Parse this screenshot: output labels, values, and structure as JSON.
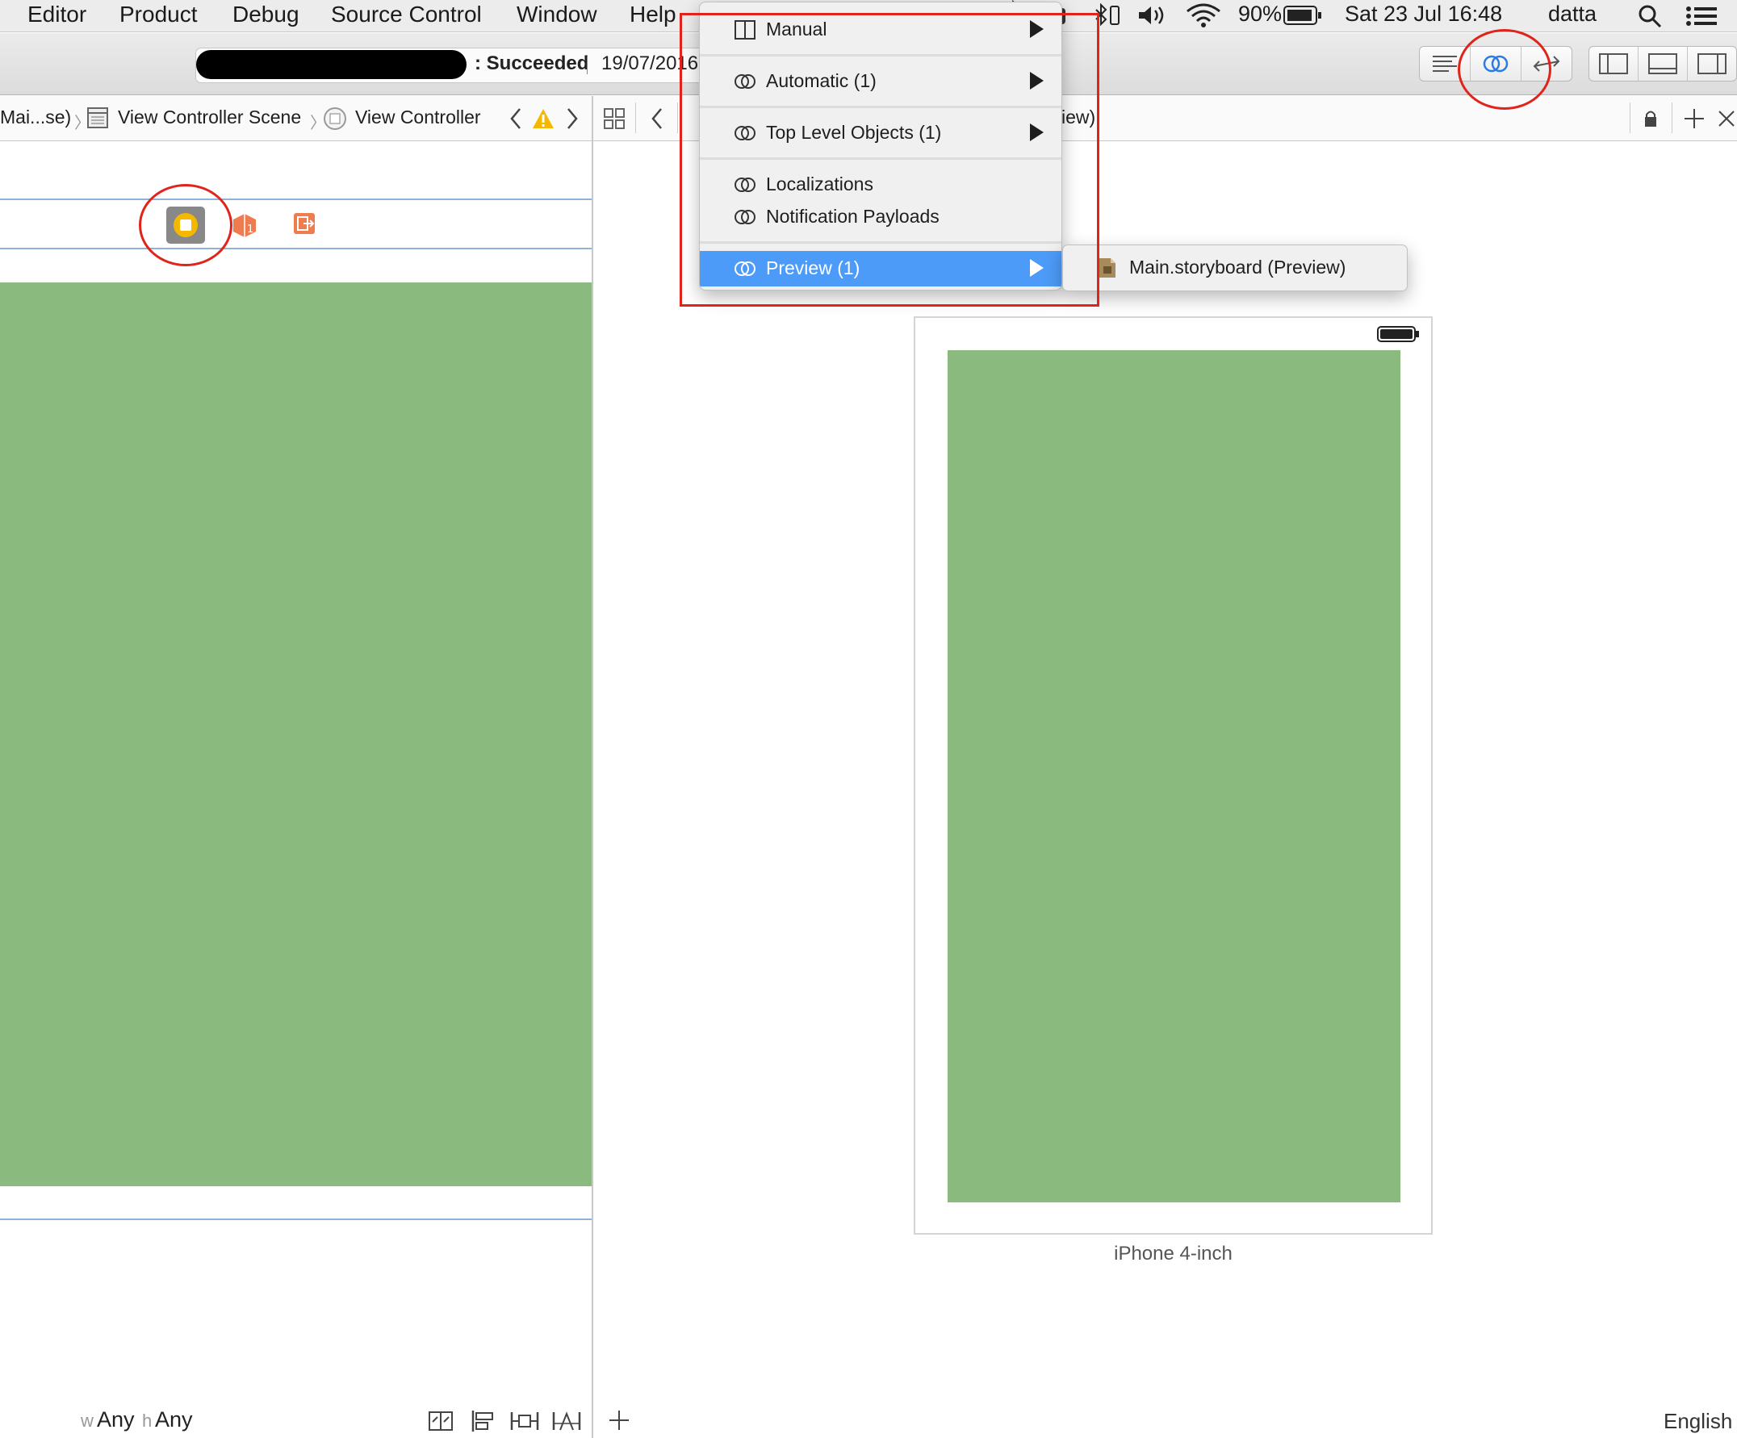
{
  "menubar": {
    "items": [
      "Editor",
      "Product",
      "Debug",
      "Source Control",
      "Window",
      "Help"
    ],
    "battery_percent": "90%",
    "datetime": "Sat 23 Jul  16:48",
    "user": "datta"
  },
  "toolbar": {
    "status": ": Succeeded",
    "date": "19/07/2016"
  },
  "jumpbar_left": {
    "file": "Mai...se)",
    "scene": "View Controller Scene",
    "controller": "View Controller"
  },
  "jumpbar_right": {
    "partial_title": "iew)"
  },
  "editor_menu": {
    "items": [
      {
        "label": "Manual",
        "has_submenu": true
      },
      {
        "label": "Automatic (1)",
        "has_submenu": true
      },
      {
        "label": "Top Level Objects (1)",
        "has_submenu": true
      },
      {
        "label": "Localizations",
        "has_submenu": false
      },
      {
        "label": "Notification Payloads",
        "has_submenu": false
      },
      {
        "label": "Preview (1)",
        "has_submenu": true,
        "highlighted": true
      }
    ],
    "submenu_item": "Main.storyboard (Preview)"
  },
  "preview": {
    "device_label": "iPhone 4-inch",
    "language": "English"
  },
  "size_class": {
    "w_prefix": "w",
    "w_value": "Any",
    "h_prefix": "h",
    "h_value": "Any"
  },
  "colors": {
    "view_background": "#8bba7e",
    "menu_highlight": "#4d9bf8",
    "annotation": "#e0241c"
  }
}
